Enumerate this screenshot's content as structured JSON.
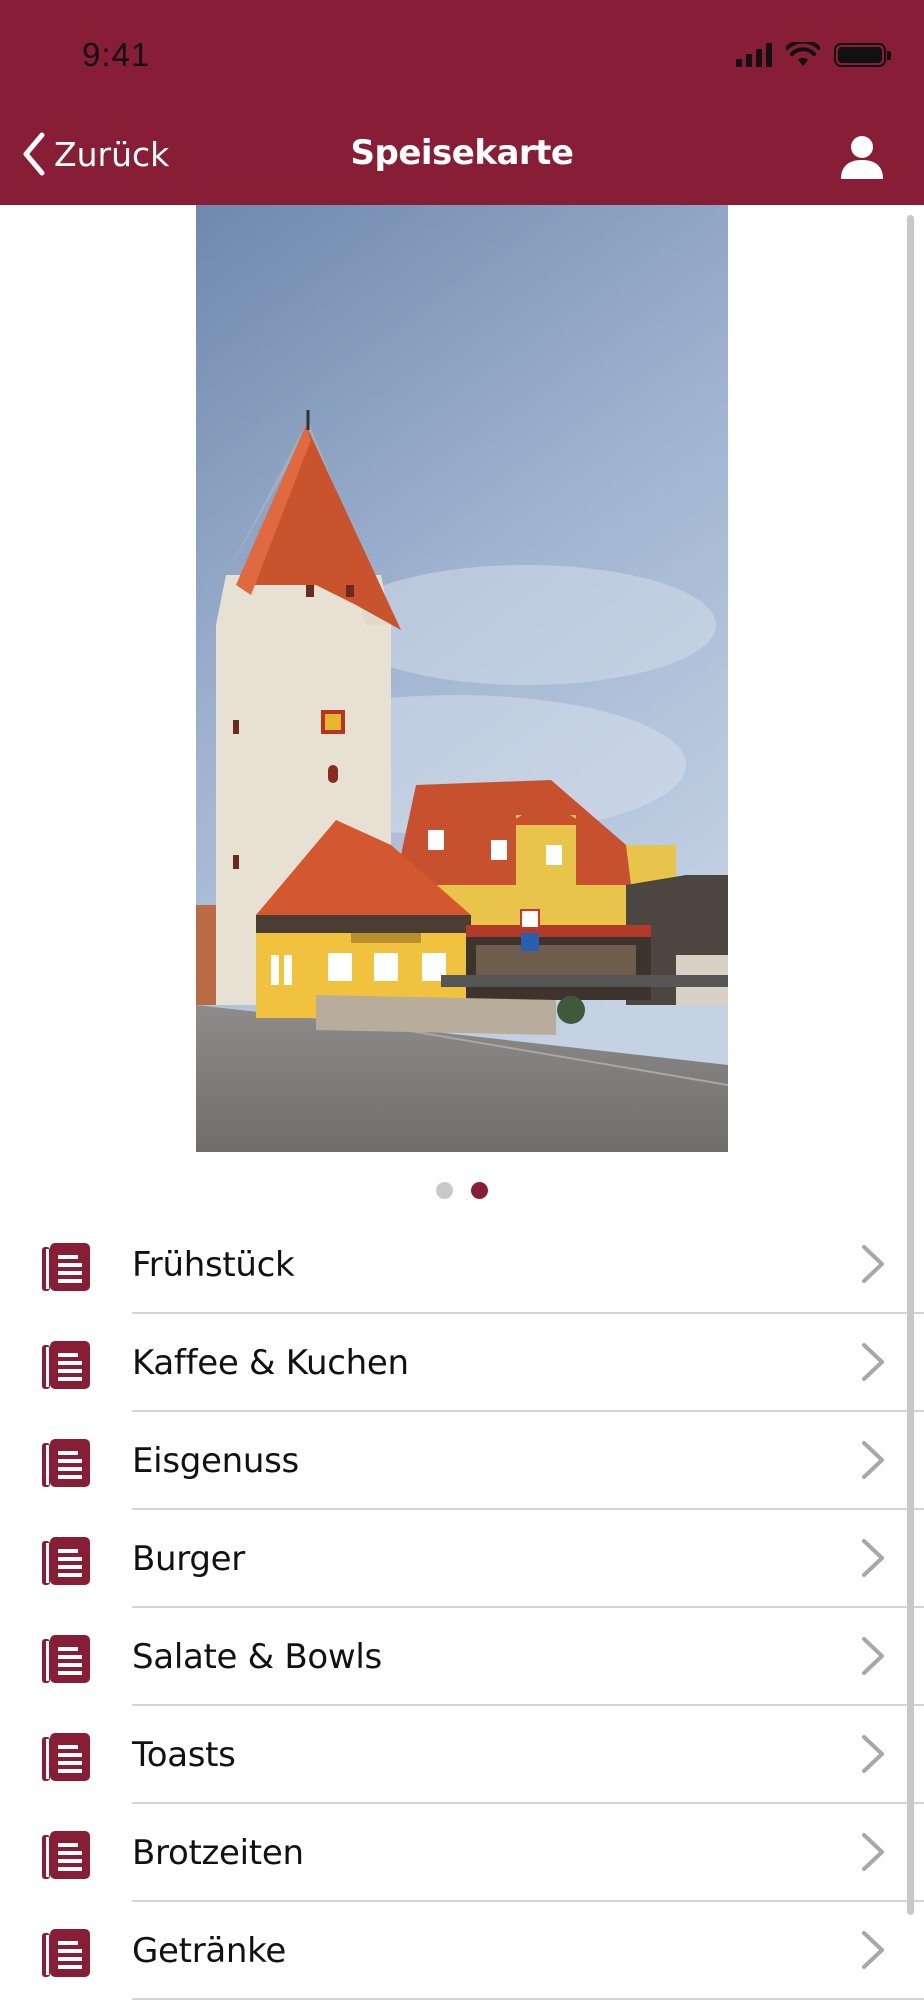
{
  "status_bar": {
    "time": "9:41"
  },
  "nav": {
    "back_label": "Zurück",
    "title": "Speisekarte"
  },
  "colors": {
    "brand": "#871e35"
  },
  "carousel": {
    "page_count": 2,
    "active_page": 2
  },
  "menu": {
    "items": [
      {
        "label": "Frühstück"
      },
      {
        "label": "Kaffee & Kuchen"
      },
      {
        "label": "Eisgenuss"
      },
      {
        "label": "Burger"
      },
      {
        "label": "Salate & Bowls"
      },
      {
        "label": "Toasts"
      },
      {
        "label": "Brotzeiten"
      },
      {
        "label": "Getränke"
      }
    ]
  }
}
